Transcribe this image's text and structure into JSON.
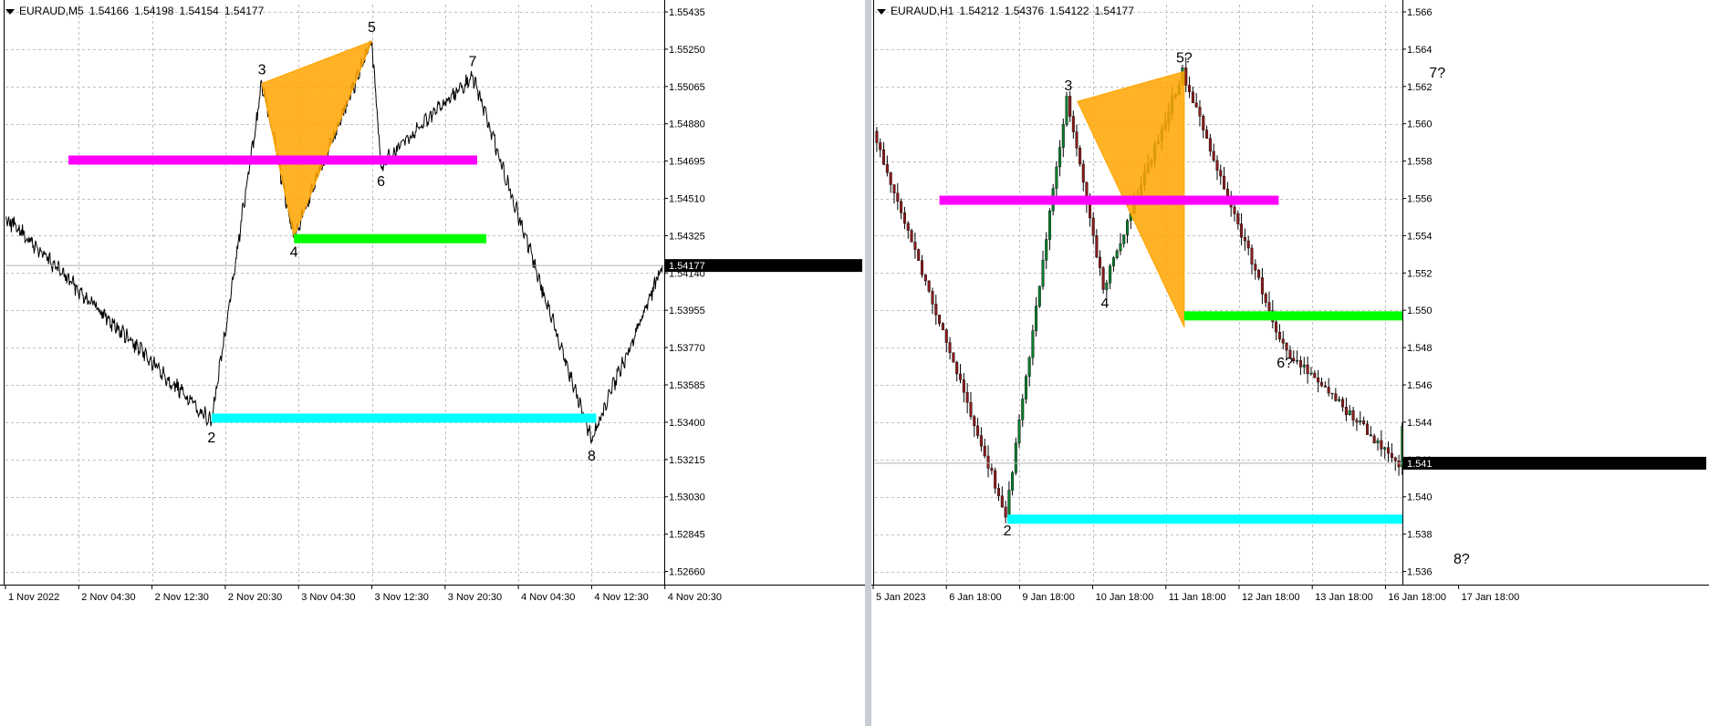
{
  "charts": [
    {
      "symbol": "EURAUD,M5",
      "ohlc": [
        "1.54166",
        "1.54198",
        "1.54154",
        "1.54177"
      ],
      "current_price": "1.54177",
      "price_ticks": [
        1.55435,
        1.5525,
        1.55065,
        1.5488,
        1.54695,
        1.5451,
        1.54325,
        1.5414,
        1.53955,
        1.5377,
        1.53585,
        1.534,
        1.53215,
        1.5303,
        1.52845,
        1.5266
      ],
      "price_tick_labels": [
        "1.55435",
        "1.55250",
        "1.55065",
        "1.54880",
        "1.54695",
        "1.54510",
        "1.54325",
        "1.54140",
        "1.53955",
        "1.53770",
        "1.53585",
        "1.53400",
        "1.53215",
        "1.53030",
        "1.52845",
        "1.52660"
      ],
      "time_labels": [
        "1 Nov 2022",
        "2 Nov 04:30",
        "2 Nov 12:30",
        "2 Nov 20:30",
        "3 Nov 04:30",
        "3 Nov 12:30",
        "3 Nov 20:30",
        "4 Nov 04:30",
        "4 Nov 12:30",
        "4 Nov 20:30"
      ],
      "pattern_points": [
        {
          "label": "2",
          "x": "2 Nov 19:00",
          "y": 1.534
        },
        {
          "label": "3",
          "x": "3 Nov 00:30",
          "y": 1.5508
        },
        {
          "label": "4",
          "x": "3 Nov 04:00",
          "y": 1.5432
        },
        {
          "label": "5",
          "x": "3 Nov 12:30",
          "y": 1.5529
        },
        {
          "label": "6",
          "x": "3 Nov 13:30",
          "y": 1.5467
        },
        {
          "label": "7",
          "x": "3 Nov 23:30",
          "y": 1.5512
        },
        {
          "label": "8",
          "x": "4 Nov 12:30",
          "y": 1.5331
        }
      ],
      "levels": [
        {
          "color": "#ff00ff",
          "price": 1.547,
          "x_start": "2 Nov 00:30",
          "x_end": "4 Nov 00:00"
        },
        {
          "color": "#00ff00",
          "price": 1.5431,
          "x_start": "3 Nov 04:00",
          "x_end": "4 Nov 01:00"
        },
        {
          "color": "#00ffff",
          "price": 1.5342,
          "x_start": "2 Nov 19:00",
          "x_end": "4 Nov 13:00"
        }
      ],
      "triangle": {
        "color": "#ffa500",
        "vertices": [
          {
            "x": "3 Nov 00:30",
            "y": 1.5508
          },
          {
            "x": "3 Nov 04:00",
            "y": 1.5432
          },
          {
            "x": "3 Nov 12:30",
            "y": 1.5529
          }
        ]
      }
    },
    {
      "symbol": "EURAUD,H1",
      "ohlc": [
        "1.54212",
        "1.54376",
        "1.54122",
        "1.54177"
      ],
      "current_price": "1.541",
      "price_ticks": [
        1.566,
        1.564,
        1.562,
        1.56,
        1.558,
        1.556,
        1.554,
        1.552,
        1.55,
        1.548,
        1.546,
        1.544,
        1.542,
        1.54,
        1.538,
        1.536
      ],
      "price_tick_labels": [
        "1.566",
        "1.564",
        "1.562",
        "1.560",
        "1.558",
        "1.556",
        "1.554",
        "1.552",
        "1.550",
        "1.548",
        "1.546",
        "1.544",
        "1.542",
        "1.540",
        "1.538",
        "1.536"
      ],
      "time_labels": [
        "5 Jan 2023",
        "6 Jan 18:00",
        "9 Jan 18:00",
        "10 Jan 18:00",
        "11 Jan 18:00",
        "12 Jan 18:00",
        "13 Jan 18:00",
        "16 Jan 18:00",
        "17 Jan 18:00"
      ],
      "pattern_points": [
        {
          "label": "2",
          "x": "9 Jan 06:00",
          "y": 1.539
        },
        {
          "label": "3",
          "x": "10 Jan 10:00",
          "y": 1.5613
        },
        {
          "label": "4",
          "x": "10 Jan 22:00",
          "y": 1.5512
        },
        {
          "label": "5?",
          "x": "12 Jan 00:00",
          "y": 1.5628
        },
        {
          "label": "6?",
          "x": "13 Jan 09:00",
          "y": 1.548
        },
        {
          "label": "7?",
          "x": "17 Jan 11:00",
          "y": 1.562
        },
        {
          "label": "8?",
          "x": "17 Jan 19:00",
          "y": 1.5375
        }
      ],
      "levels": [
        {
          "color": "#ff00ff",
          "price": 1.5559,
          "x_start": "6 Jan 14:00",
          "x_end": "13 Jan 07:00"
        },
        {
          "color": "#00ff00",
          "price": 1.5497,
          "x_start": "12 Jan 00:00",
          "x_end": "17 Jan 09:00"
        },
        {
          "color": "#00ffff",
          "price": 1.5388,
          "x_start": "9 Jan 06:00",
          "x_end": "18 Jan 00:00"
        }
      ],
      "triangle": {
        "color": "#ffa500",
        "vertices": [
          {
            "x": "10 Jan 13:00",
            "y": 1.5612
          },
          {
            "x": "12 Jan 00:00",
            "y": 1.5628
          },
          {
            "x": "12 Jan 00:00",
            "y": 1.5491
          }
        ]
      }
    }
  ]
}
